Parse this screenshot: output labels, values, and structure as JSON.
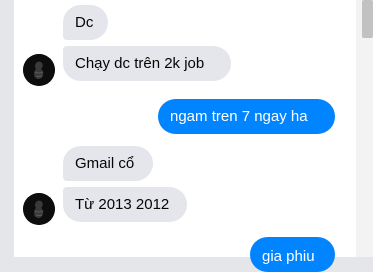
{
  "messages": [
    {
      "text": "Dc",
      "from": "them"
    },
    {
      "text": "Chạy dc trên 2k job",
      "from": "them"
    },
    {
      "text": "ngam tren 7 ngay ha",
      "from": "me"
    },
    {
      "text": "Gmail cổ",
      "from": "them"
    },
    {
      "text": "Từ 2013 2012",
      "from": "them"
    },
    {
      "text": "gia phiu",
      "from": "me"
    }
  ],
  "colors": {
    "incoming_bubble": "#e4e6eb",
    "outgoing_bubble": "#0084ff",
    "background": "#e4e6ea"
  },
  "icons": {
    "avatar": "contact-avatar"
  }
}
